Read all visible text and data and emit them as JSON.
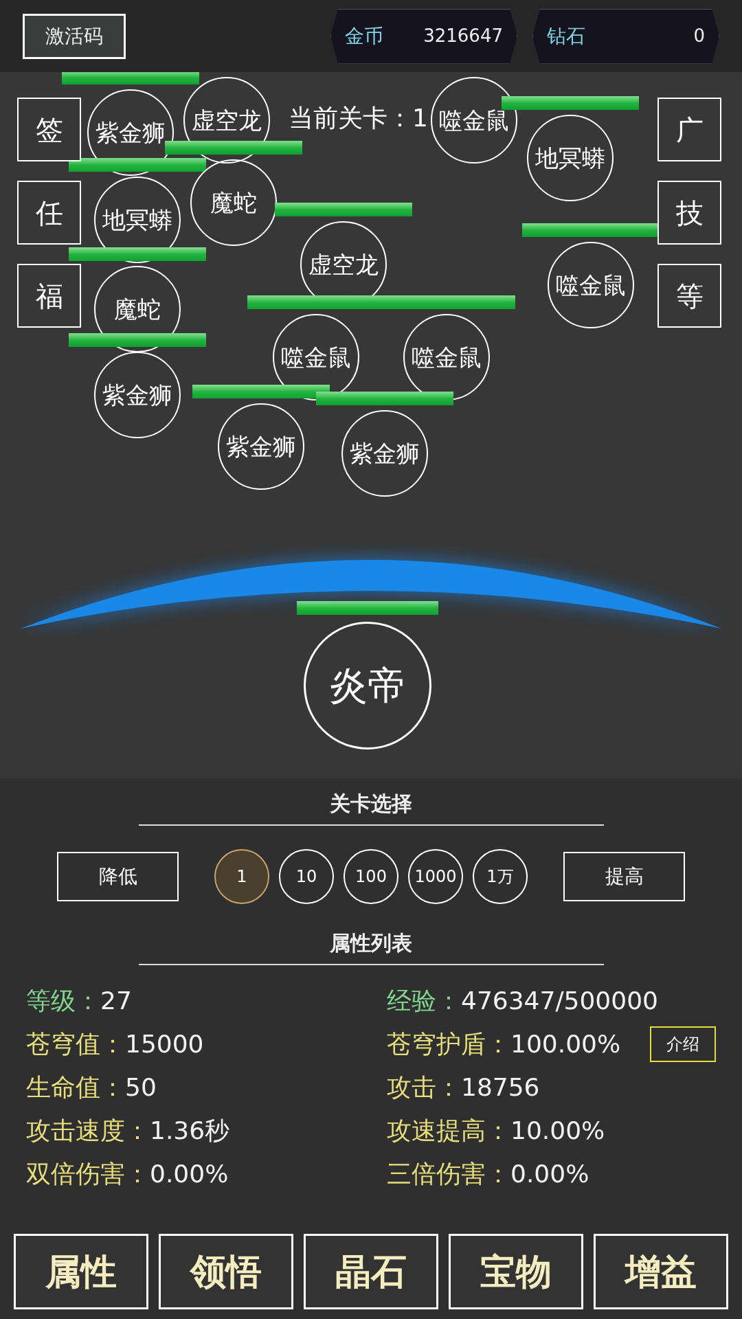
{
  "top_bar": {
    "activation_button": "激活码",
    "currencies": [
      {
        "label": "金币",
        "value": "3216647"
      },
      {
        "label": "钻石",
        "value": "0"
      }
    ]
  },
  "battlefield": {
    "stage_label": "当前关卡：1",
    "left_buttons": [
      "签",
      "任",
      "福"
    ],
    "right_buttons": [
      "广",
      "技",
      "等"
    ],
    "enemies": [
      {
        "name": "紫金狮"
      },
      {
        "name": "虚空龙"
      },
      {
        "name": "地冥蟒"
      },
      {
        "name": "魔蛇"
      },
      {
        "name": "虚空龙"
      },
      {
        "name": "噬金鼠"
      },
      {
        "name": "地冥蟒"
      },
      {
        "name": "噬金鼠"
      },
      {
        "name": "魔蛇"
      },
      {
        "name": "紫金狮"
      },
      {
        "name": "噬金鼠"
      },
      {
        "name": "噬金鼠"
      },
      {
        "name": "紫金狮"
      },
      {
        "name": "紫金狮"
      }
    ],
    "hero": {
      "name": "炎帝"
    }
  },
  "stage_select": {
    "title": "关卡选择",
    "decrease": "降低",
    "increase": "提高",
    "steps": [
      {
        "label": "1",
        "selected": true
      },
      {
        "label": "10",
        "selected": false
      },
      {
        "label": "100",
        "selected": false
      },
      {
        "label": "1000",
        "selected": false
      },
      {
        "label": "1万",
        "selected": false
      }
    ]
  },
  "attributes": {
    "title": "属性列表",
    "items": [
      {
        "label": "等级：",
        "value": "27",
        "kind": "primary"
      },
      {
        "label": "经验：",
        "value": "476347/500000",
        "kind": "primary"
      },
      {
        "label": "苍穹值：",
        "value": "15000",
        "kind": "normal"
      },
      {
        "label": "苍穹护盾：",
        "value": "100.00%",
        "kind": "normal",
        "button": "介绍"
      },
      {
        "label": "生命值：",
        "value": "50",
        "kind": "normal"
      },
      {
        "label": "攻击：",
        "value": "18756",
        "kind": "normal"
      },
      {
        "label": "攻击速度：",
        "value": "1.36秒",
        "kind": "normal"
      },
      {
        "label": "攻速提高：",
        "value": "10.00%",
        "kind": "normal"
      },
      {
        "label": "双倍伤害：",
        "value": "0.00%",
        "kind": "normal"
      },
      {
        "label": "三倍伤害：",
        "value": "0.00%",
        "kind": "normal"
      }
    ]
  },
  "bottom_tabs": [
    "属性",
    "领悟",
    "晶石",
    "宝物",
    "增益"
  ]
}
